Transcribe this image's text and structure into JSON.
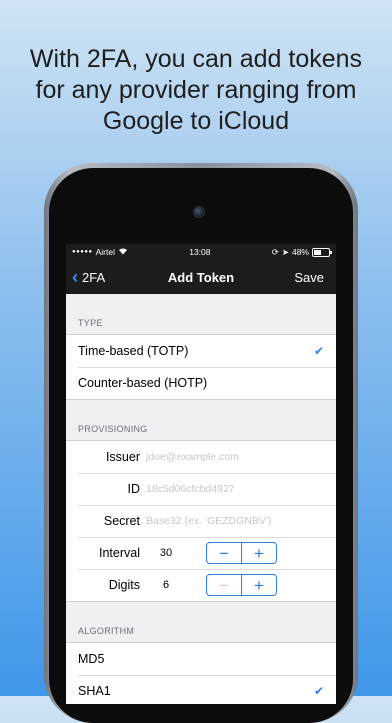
{
  "headline": {
    "line1": "With 2FA, you can add tokens",
    "line2": "for any provider ranging from",
    "line3": "Google to iCloud"
  },
  "status_bar": {
    "carrier": "Airtel",
    "time": "13:08",
    "battery": "48%"
  },
  "nav": {
    "back_label": "2FA",
    "title": "Add Token",
    "save_label": "Save",
    "back_icon": "chevron-left-icon"
  },
  "sections": {
    "type_header": "TYPE",
    "type_options": [
      "Time-based (TOTP)",
      "Counter-based (HOTP)"
    ],
    "type_selected": "Time-based (TOTP)",
    "provisioning_header": "PROVISIONING",
    "algorithm_header": "ALGORITHM",
    "algorithm_options": [
      "MD5",
      "SHA1"
    ],
    "algorithm_selected": "SHA1"
  },
  "fields": {
    "issuer": {
      "label": "Issuer",
      "placeholder": "jdoe@example.com",
      "value": ""
    },
    "id": {
      "label": "ID",
      "placeholder": "18c5d06cfcbd4927",
      "value": ""
    },
    "secret": {
      "label": "Secret",
      "placeholder": "Base32 (ex. 'GEZDGNBV')",
      "value": ""
    },
    "interval": {
      "label": "Interval",
      "value": "30"
    },
    "digits": {
      "label": "Digits",
      "value": "6"
    }
  },
  "colors": {
    "accent": "#2f7fe6",
    "navbar": "#1c1c1e",
    "background_top": "#cfe3f3",
    "background_bottom": "#3f97ea"
  }
}
